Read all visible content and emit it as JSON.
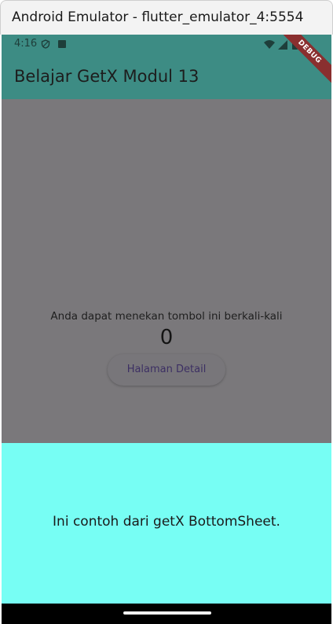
{
  "window": {
    "title": "Android Emulator - flutter_emulator_4:5554"
  },
  "status_bar": {
    "time": "4:16",
    "icons": [
      "shield-icon",
      "notification-a-icon",
      "wifi-icon",
      "signal-icon",
      "battery-icon"
    ]
  },
  "app_bar": {
    "title": "Belajar GetX Modul 13",
    "color": "#3d8c84"
  },
  "debug_banner": {
    "label": "DEBUG"
  },
  "body": {
    "hint": "Anda dapat menekan tombol ini berkali-kali",
    "counter": "0",
    "detail_button_label": "Halaman Detail"
  },
  "bottom_sheet": {
    "text": "Ini contoh dari getX BottomSheet.",
    "color": "#77fef4"
  }
}
